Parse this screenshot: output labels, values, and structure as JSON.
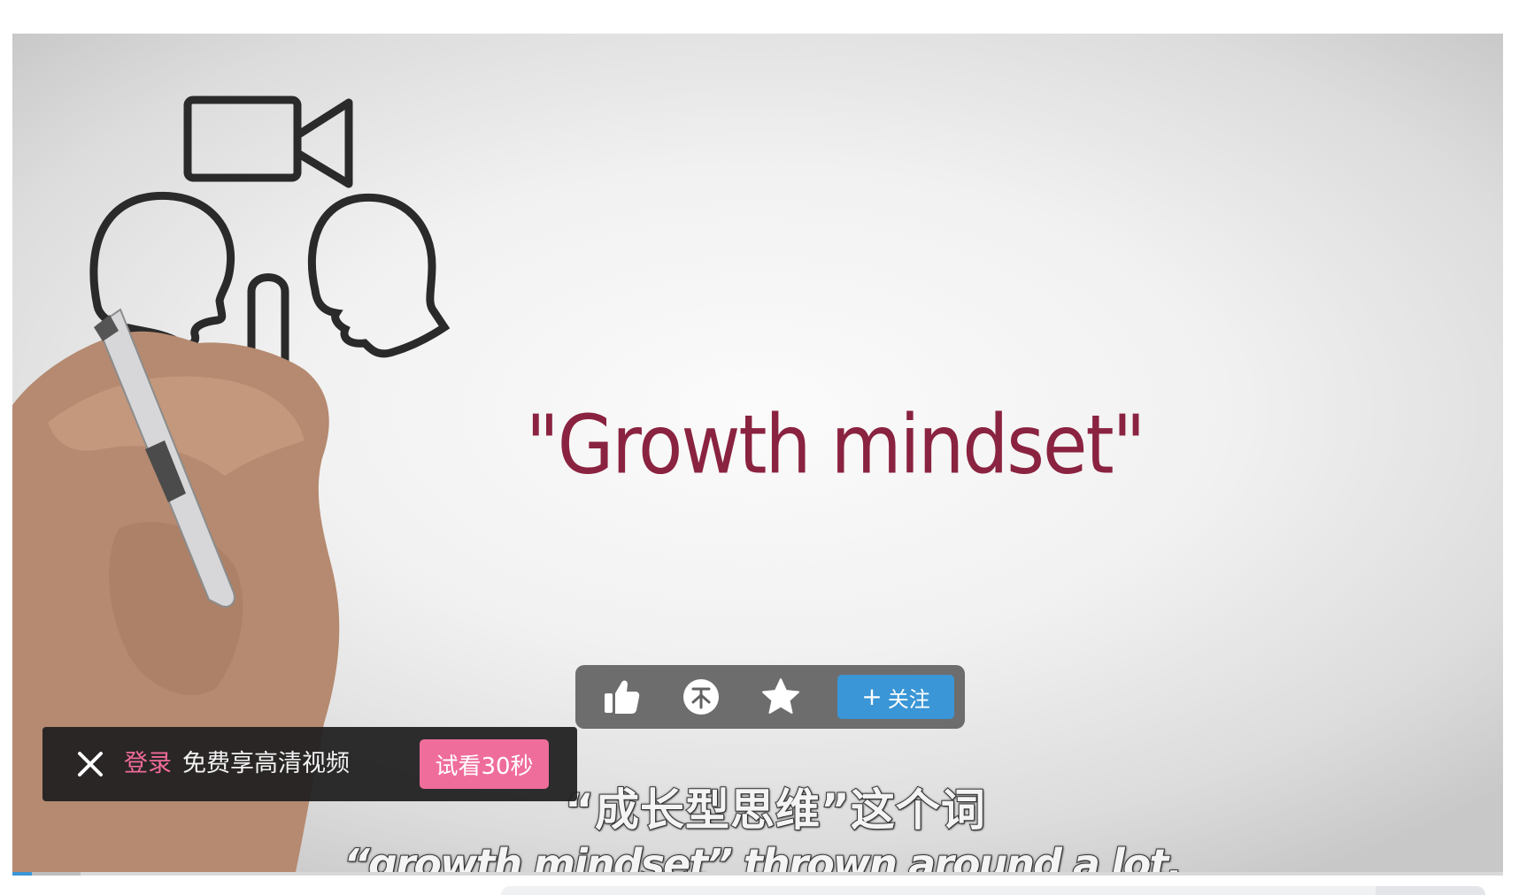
{
  "video": {
    "drawn_text": "\"Growth mindset\"",
    "subtitle_cn": "“成长型思维”这个词",
    "subtitle_en": "“growth mindset” thrown around a lot.",
    "progress_fraction": 0.013,
    "buffer_fraction": 0.046
  },
  "action_bar": {
    "icons": {
      "like": "thumbs-up-icon",
      "coin": "coin-icon",
      "favorite": "star-icon"
    },
    "follow_plus": "+",
    "follow_label": "关注",
    "button_color": "#3a96d6"
  },
  "login_banner": {
    "close_icon": "close-icon",
    "login_label": "登录",
    "promo_text": "免费享高清视频",
    "trial_button": "试看30秒",
    "accent_color": "#ef6d9b"
  }
}
